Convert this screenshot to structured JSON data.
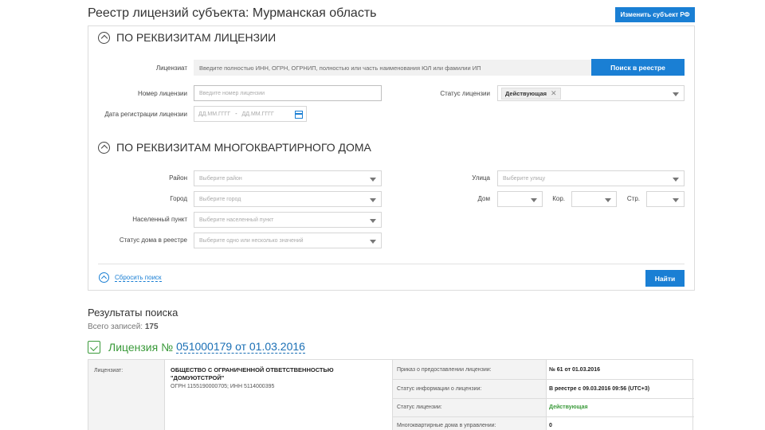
{
  "header": {
    "title": "Реестр лицензий субъекта: Мурманская область",
    "change_button": "Изменить субъект РФ"
  },
  "license_section": {
    "title": "ПО РЕКВИЗИТАМ ЛИЦЕНЗИИ",
    "licensee_label": "Лицензиат",
    "licensee_placeholder": "Введите полностью ИНН, ОГРН, ОГРНИП, полностью или часть наименования ЮЛ или фамилии ИП",
    "search_button": "Поиск в реестре",
    "number_label": "Номер лицензии",
    "number_placeholder": "Введите номер лицензии",
    "status_label": "Статус лицензии",
    "status_value": "Действующая",
    "date_label": "Дата регистрации лицензии",
    "date_from_placeholder": "ДД.ММ.ГГГГ",
    "date_separator": "-",
    "date_to_placeholder": "ДД.ММ.ГГГГ"
  },
  "house_section": {
    "title": "ПО РЕКВИЗИТАМ МНОГОКВАРТИРНОГО ДОМА",
    "district_label": "Район",
    "district_placeholder": "Выберите район",
    "city_label": "Город",
    "city_placeholder": "Выберите город",
    "locality_label": "Населенный пункт",
    "locality_placeholder": "Выберите населенный пункт",
    "house_status_label": "Статус дома в реестре",
    "house_status_placeholder": "Выберите одно или несколько значений",
    "street_label": "Улица",
    "street_placeholder": "Выберите улицу",
    "house_label": "Дом",
    "building_label": "Кор.",
    "structure_label": "Стр."
  },
  "actions": {
    "reset_label": "Сбросить поиск",
    "find_button": "Найти"
  },
  "results": {
    "title": "Результаты поиска",
    "total_label": "Всего записей:",
    "total_count": "175"
  },
  "license": {
    "prefix": "Лицензия №",
    "number_link": "051000179 от 01.03.2016",
    "licensee_label": "Лицензиат:",
    "org_name_line1": "ОБЩЕСТВО С ОГРАНИЧЕННОЙ ОТВЕТСТВЕННОСТЬЮ",
    "org_name_line2": "\"ДОМУЮТСТРОЙ\"",
    "org_ids": "ОГРН 1155190000705; ИНН 5114000395",
    "order_label": "Приказ о предоставлении лицензии:",
    "order_value": "№ 61 от 01.03.2016",
    "info_status_label": "Статус информации о лицензии:",
    "info_status_value": "В реестре с 09.03.2016 09:56 (UTC+3)",
    "license_status_label": "Статус лицензии:",
    "license_status_value": "Действующая",
    "houses_label": "Многоквартирные дома в управлении:",
    "houses_value": "0"
  },
  "colors": {
    "accent": "#1a7fd4",
    "license_green": "#3a9a3a"
  }
}
